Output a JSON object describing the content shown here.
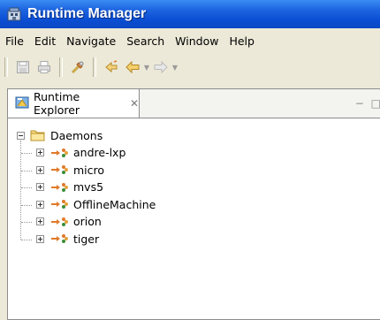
{
  "window": {
    "title": "Runtime Manager"
  },
  "menu": [
    "File",
    "Edit",
    "Navigate",
    "Search",
    "Window",
    "Help"
  ],
  "toolbar": {
    "buttons": [
      "save-icon",
      "print-icon",
      "connect-icon",
      "refresh-icon",
      "back-icon",
      "forward-icon"
    ]
  },
  "view": {
    "tab_label": "Runtime Explorer",
    "close_glyph": "✕",
    "controls": "− □"
  },
  "tree": {
    "root_label": "Daemons",
    "children": [
      {
        "label": "andre-lxp"
      },
      {
        "label": "micro"
      },
      {
        "label": "mvs5"
      },
      {
        "label": "OfflineMachine"
      },
      {
        "label": "orion"
      },
      {
        "label": "tiger"
      }
    ]
  }
}
